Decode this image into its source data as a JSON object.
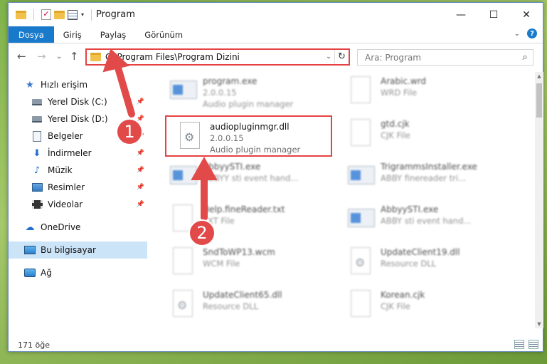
{
  "window": {
    "title": "Program",
    "quick_access_chevron": "▾"
  },
  "window_controls": {
    "minimize": "—",
    "maximize": "☐",
    "close": "✕"
  },
  "ribbon": {
    "tabs": [
      {
        "label": "Dosya"
      },
      {
        "label": "Giriş"
      },
      {
        "label": "Paylaş"
      },
      {
        "label": "Görünüm"
      }
    ],
    "collapse": "⌄",
    "help": "?"
  },
  "address_bar": {
    "back": "←",
    "forward": "→",
    "recent": "⌄",
    "up": "↑",
    "path": "C:\\Program Files\\Program Dizini",
    "dropdown": "⌄",
    "refresh": "↻"
  },
  "search": {
    "placeholder": "Ara: Program",
    "icon": "⌕"
  },
  "sidebar": {
    "items": [
      {
        "label": "Hızlı erişim",
        "icon": "star-icon"
      },
      {
        "label": "Yerel Disk (C:)",
        "icon": "disk-icon",
        "pinned": true
      },
      {
        "label": "Yerel Disk (D:)",
        "icon": "disk-icon",
        "pinned": true
      },
      {
        "label": "Belgeler",
        "icon": "document-icon",
        "pinned": true
      },
      {
        "label": "İndirmeler",
        "icon": "download-icon",
        "pinned": true
      },
      {
        "label": "Müzik",
        "icon": "music-icon",
        "pinned": true
      },
      {
        "label": "Resimler",
        "icon": "pictures-icon",
        "pinned": true
      },
      {
        "label": "Videolar",
        "icon": "videos-icon",
        "pinned": true
      },
      {
        "label": "OneDrive",
        "icon": "cloud-icon"
      },
      {
        "label": "Bu bilgisayar",
        "icon": "computer-icon",
        "selected": true
      },
      {
        "label": "Ağ",
        "icon": "network-icon"
      }
    ],
    "pin_glyph": "📌",
    "icon_glyphs": {
      "star": "★",
      "download": "⬇",
      "music": "♪",
      "cloud": "☁"
    }
  },
  "files": [
    {
      "name": "program.exe",
      "line2": "2.0.0.15",
      "line3": "Audio plugin manager",
      "kind": "exe"
    },
    {
      "name": "Arabic.wrd",
      "line2": "WRD File",
      "line3": "",
      "kind": "page"
    },
    {
      "name": "audiopluginmgr.dll",
      "line2": "2.0.0.15",
      "line3": "Audio plugin manager",
      "kind": "dll",
      "highlighted": true
    },
    {
      "name": "gtd.cjk",
      "line2": "CJK File",
      "line3": "",
      "kind": "page"
    },
    {
      "name": "AbbyySTI.exe",
      "line2": "ABBYY sti event hand...",
      "line3": "",
      "kind": "exe"
    },
    {
      "name": "TrigrammsInstaller.exe",
      "line2": "ABBY finereader tri...",
      "line3": "",
      "kind": "exe"
    },
    {
      "name": "Help.fineReader.txt",
      "line2": "TXT File",
      "line3": "",
      "kind": "page"
    },
    {
      "name": "AbbyySTI.exe",
      "line2": "ABBY sti event hand...",
      "line3": "",
      "kind": "exe"
    },
    {
      "name": "SndToWP13.wcm",
      "line2": "WCM File",
      "line3": "",
      "kind": "page"
    },
    {
      "name": "UpdateClient19.dll",
      "line2": "Resource DLL",
      "line3": "",
      "kind": "dll"
    },
    {
      "name": "UpdateClient65.dll",
      "line2": "Resource DLL",
      "line3": "",
      "kind": "dll"
    },
    {
      "name": "Korean.cjk",
      "line2": "CJK File",
      "line3": "",
      "kind": "page"
    }
  ],
  "gear_glyph": "⚙",
  "status_bar": {
    "count": "171 öğe"
  },
  "annotations": [
    {
      "number": "1"
    },
    {
      "number": "2"
    }
  ],
  "colors": {
    "accent": "#1979ca",
    "highlight_red": "#e64242",
    "selected_bg": "#cce4f7"
  }
}
